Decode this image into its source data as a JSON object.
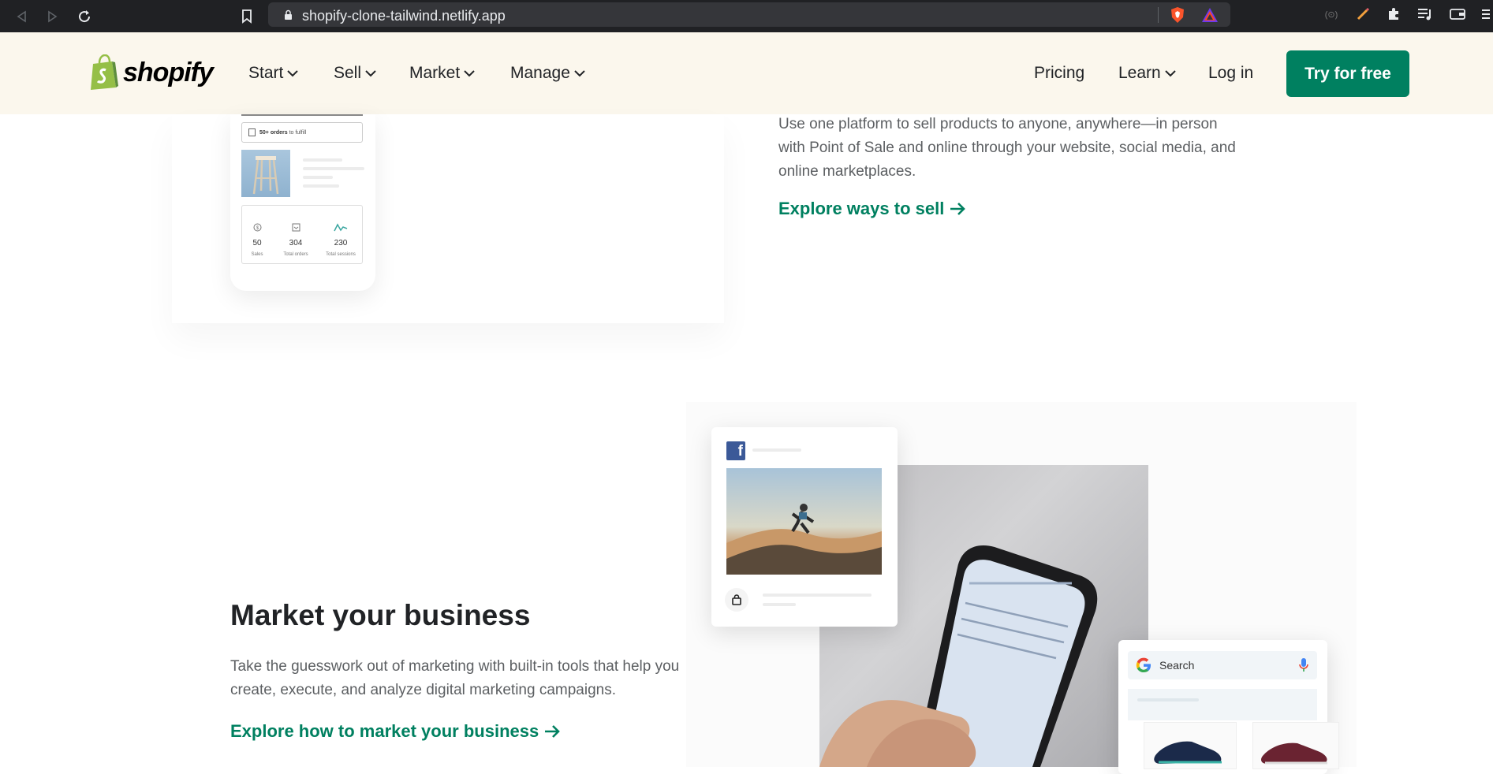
{
  "browser": {
    "url": "shopify-clone-tailwind.netlify.app",
    "icons": [
      "back-icon",
      "forward-icon",
      "reload-icon",
      "bookmark-icon",
      "lock-icon",
      "brave-shield-icon",
      "brave-rewards-icon",
      "extension-icon",
      "extensions-puzzle-icon",
      "playlist-icon",
      "wallet-icon",
      "menu-icon"
    ]
  },
  "header": {
    "logo_text": "shopify",
    "nav_left": [
      {
        "label": "Start"
      },
      {
        "label": "Sell"
      },
      {
        "label": "Market"
      },
      {
        "label": "Manage"
      }
    ],
    "pricing": "Pricing",
    "learn": "Learn",
    "login": "Log in",
    "cta": "Try for free"
  },
  "sell_section": {
    "description": "Use one platform to sell products to anyone, anywhere—in person with Point of Sale and online through your website, social media, and online marketplaces.",
    "link": "Explore ways to sell",
    "phone": {
      "orders_prefix": "50+ orders",
      "orders_suffix": "to fulfill",
      "stats": [
        {
          "value": "50",
          "label": "Sales",
          "icon": "dollar-icon"
        },
        {
          "value": "304",
          "label": "Total orders",
          "icon": "orders-icon"
        },
        {
          "value": "230",
          "label": "Total sessions",
          "icon": "trend-icon"
        }
      ]
    }
  },
  "market_section": {
    "title": "Market your business",
    "description": "Take the guesswork out of marketing with built-in tools that help you create, execute, and analyze digital marketing campaigns.",
    "link": "Explore how to market your business",
    "search_placeholder": "Search"
  },
  "colors": {
    "brand_green": "#008060",
    "header_bg": "#fbf7ed",
    "chrome_bg": "#202124"
  }
}
